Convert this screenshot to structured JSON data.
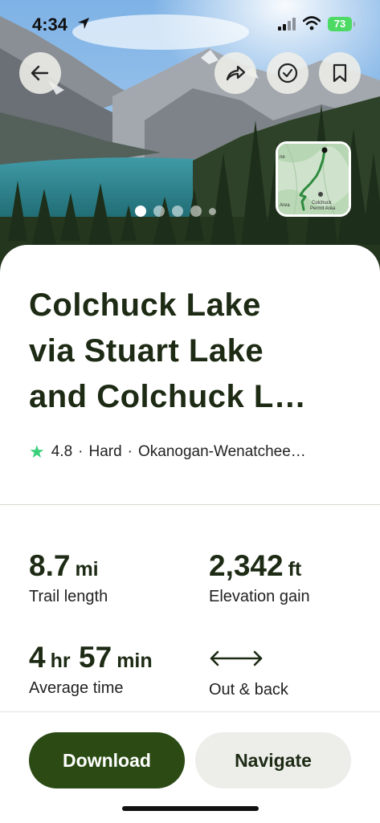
{
  "status_bar": {
    "time": "4:34",
    "battery": "73"
  },
  "hero": {
    "carousel_count": 5,
    "active_index": 0
  },
  "map_thumb": {
    "label_1": "Colchuck",
    "label_2": "Permit Area",
    "label_3": "Area",
    "label_4": "ne"
  },
  "trail": {
    "title_line_1": "Colchuck Lake",
    "title_line_2": "via Stuart Lake",
    "title_line_3": "and Colchuck L…",
    "rating": "4.8",
    "difficulty": "Hard",
    "location": "Okanogan-Wenatchee…",
    "separator": "·"
  },
  "stats": {
    "length_value": "8.7",
    "length_unit": "mi",
    "length_label": "Trail length",
    "elevation_value": "2,342",
    "elevation_unit": "ft",
    "elevation_label": "Elevation gain",
    "time_hr_value": "4",
    "time_hr_unit": "hr",
    "time_min_value": "57",
    "time_min_unit": "min",
    "time_label": "Average time",
    "route_label": "Out & back"
  },
  "actions": {
    "download_label": "Download",
    "navigate_label": "Navigate"
  },
  "colors": {
    "brand_dark_green": "#2b4a14",
    "text_dark": "#1d2a14",
    "star_green": "#3ad07a",
    "secondary_button": "#ededea"
  }
}
